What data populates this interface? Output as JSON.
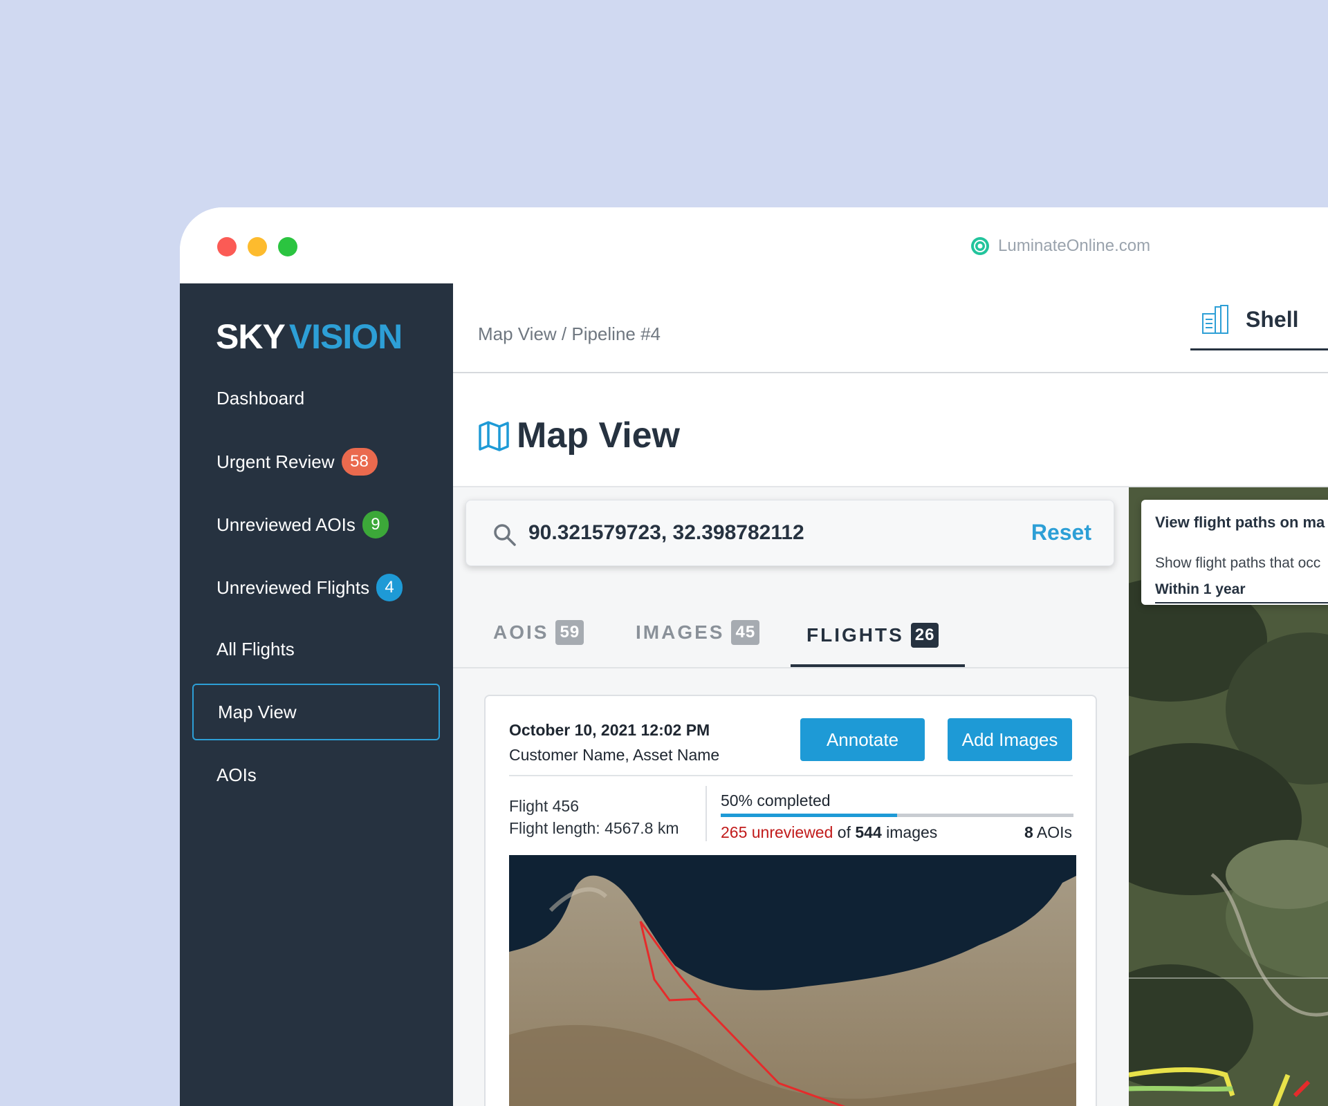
{
  "window": {
    "url": "LuminateOnline.com"
  },
  "sidebar": {
    "logo_sky": "SKY",
    "logo_vision": "VISION",
    "items": [
      {
        "label": "Dashboard"
      },
      {
        "label": "Urgent Review",
        "badge": "58"
      },
      {
        "label": "Unreviewed AOIs",
        "badge": "9"
      },
      {
        "label": "Unreviewed Flights",
        "badge": "4"
      },
      {
        "label": "All Flights"
      },
      {
        "label": "Map View",
        "active": true
      },
      {
        "label": "AOIs"
      }
    ]
  },
  "header": {
    "breadcrumb": "Map View / Pipeline #4",
    "org_name": "Shell"
  },
  "page": {
    "title": "Map View"
  },
  "search": {
    "value": "90.321579723, 32.398782112",
    "reset_label": "Reset"
  },
  "tabs": [
    {
      "label": "AOIS",
      "count": "59"
    },
    {
      "label": "IMAGES",
      "count": "45"
    },
    {
      "label": "FLIGHTS",
      "count": "26",
      "active": true
    }
  ],
  "flight_card": {
    "date": "October 10, 2021 12:02 PM",
    "customer": "Customer Name, Asset Name",
    "annotate_label": "Annotate",
    "add_images_label": "Add Images",
    "flight_name": "Flight 456",
    "flight_length": "Flight length: 4567.8 km",
    "progress_label": "50% completed",
    "progress": 0.5,
    "unreviewed_count": "265",
    "unreviewed_word": "unreviewed",
    "of_word": "of",
    "total_images": "544",
    "images_word": "images",
    "aois_count": "8",
    "aois_word": "AOIs"
  },
  "map_overlay": {
    "title": "View flight paths on ma",
    "subtitle": "Show flight paths that occ",
    "selected_range": "Within 1 year"
  },
  "colors": {
    "sidebar_bg": "#263240",
    "accent": "#2d9fd6",
    "urgent_badge": "#ea6a4e",
    "green_badge": "#3ca839",
    "blue_badge": "#1e9ad6",
    "unreviewed_red": "#c11b1b"
  },
  "icons": {
    "url": "luminate-logo-icon",
    "org": "building-icon",
    "title": "map-icon",
    "search": "search-icon"
  }
}
